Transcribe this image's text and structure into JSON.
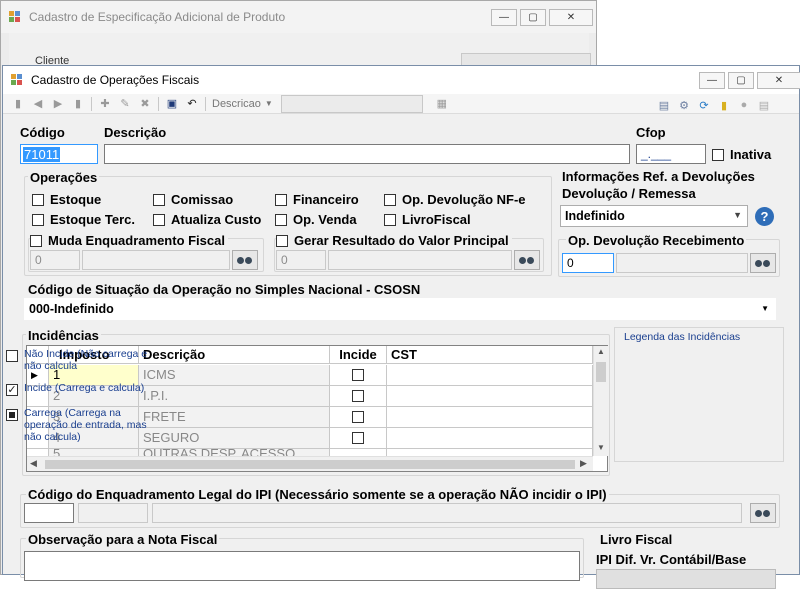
{
  "background_window": {
    "title": "Cadastro de Especificação Adicional de Produto",
    "field_label": "Cliente"
  },
  "window": {
    "title": "Cadastro de Operações Fiscais"
  },
  "toolbar": {
    "search_dropdown": "Descricao"
  },
  "fields": {
    "codigo_label": "Código",
    "codigo_value": "71011",
    "descricao_label": "Descrição",
    "cfop_label": "Cfop",
    "cfop_value": "_.___",
    "inativa_label": "Inativa"
  },
  "operacoes": {
    "title": "Operações",
    "checks": [
      "Estoque",
      "Comissao",
      "Financeiro",
      "Op. Devolução NF-e",
      "Estoque Terc.",
      "Atualiza Custo",
      "Op. Venda",
      "LivroFiscal"
    ],
    "muda_label": "Muda Enquadramento Fiscal",
    "muda_value": "0",
    "gerar_label": "Gerar Resultado do Valor Principal",
    "gerar_value": "0"
  },
  "devolucoes": {
    "title_line1": "Informações Ref. a Devoluções",
    "title_line2": "Devolução / Remessa",
    "select_value": "Indefinido",
    "recebimento_label": "Op. Devolução Recebimento",
    "recebimento_value": "0"
  },
  "csosn": {
    "label": "Código de Situação da Operação no Simples Nacional - CSOSN",
    "value": "000-Indefinido"
  },
  "incidencias": {
    "title": "Incidências",
    "columns": [
      "Imposto",
      "Descrição",
      "Incide",
      "CST"
    ],
    "rows": [
      {
        "imposto": "1",
        "descricao": "ICMS"
      },
      {
        "imposto": "2",
        "descricao": "I.P.I."
      },
      {
        "imposto": "3",
        "descricao": "FRETE"
      },
      {
        "imposto": "4",
        "descricao": "SEGURO"
      },
      {
        "imposto": "5",
        "descricao": "OUTRAS DESP. ACESSO"
      }
    ]
  },
  "legenda": {
    "title": "Legenda das Incidências",
    "items": [
      "Não Incide (Não carrega e não calcula",
      "Incide (Carrega e calcula)",
      "Carrega (Carrega na operação de entrada, mas não calcula)"
    ]
  },
  "ipi": {
    "label": "Código do Enquadramento Legal do IPI (Necessário somente se a operação NÃO incidir o IPI)"
  },
  "observacao": {
    "label": "Observação para a Nota Fiscal"
  },
  "livro": {
    "title": "Livro Fiscal",
    "ipi_label": "IPI Dif. Vr. Contábil/Base"
  },
  "colors": {
    "accent": "#1a3f8f",
    "focus": "#3399ff"
  }
}
